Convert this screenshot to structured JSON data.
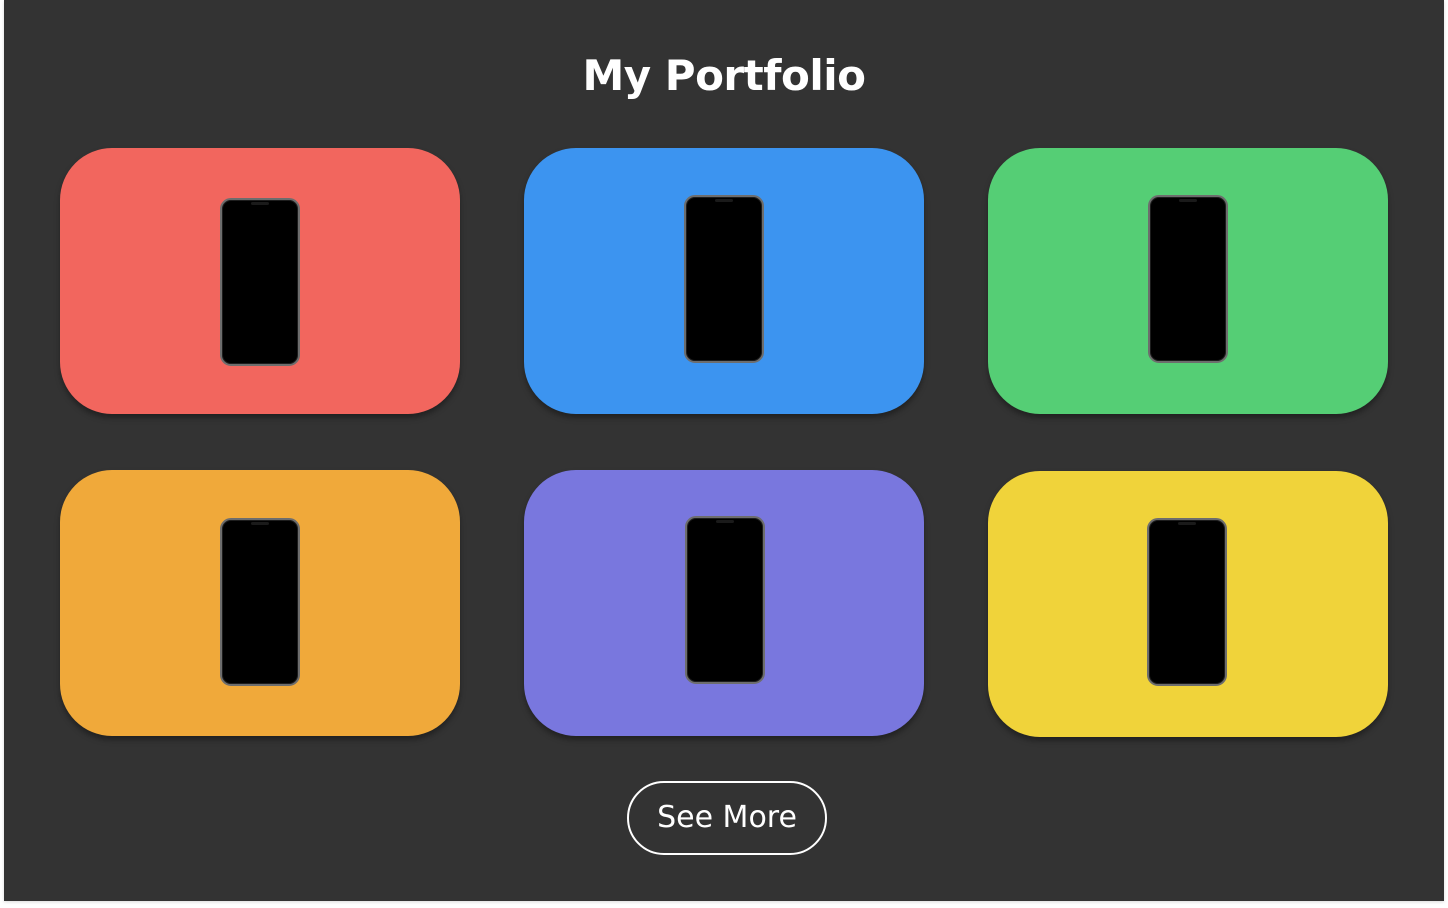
{
  "header": {
    "title": "My Portfolio"
  },
  "portfolio": {
    "items": [
      {
        "color": "#F2665E",
        "icon": "smartphone-mockup"
      },
      {
        "color": "#3C94F0",
        "icon": "smartphone-mockup"
      },
      {
        "color": "#55CE75",
        "icon": "smartphone-mockup"
      },
      {
        "color": "#F0A93A",
        "icon": "smartphone-mockup"
      },
      {
        "color": "#7977DE",
        "icon": "smartphone-mockup"
      },
      {
        "color": "#F0D33A",
        "icon": "smartphone-mockup"
      }
    ]
  },
  "actions": {
    "see_more_label": "See More"
  },
  "theme": {
    "background": "#333333",
    "text": "#FFFFFF"
  }
}
